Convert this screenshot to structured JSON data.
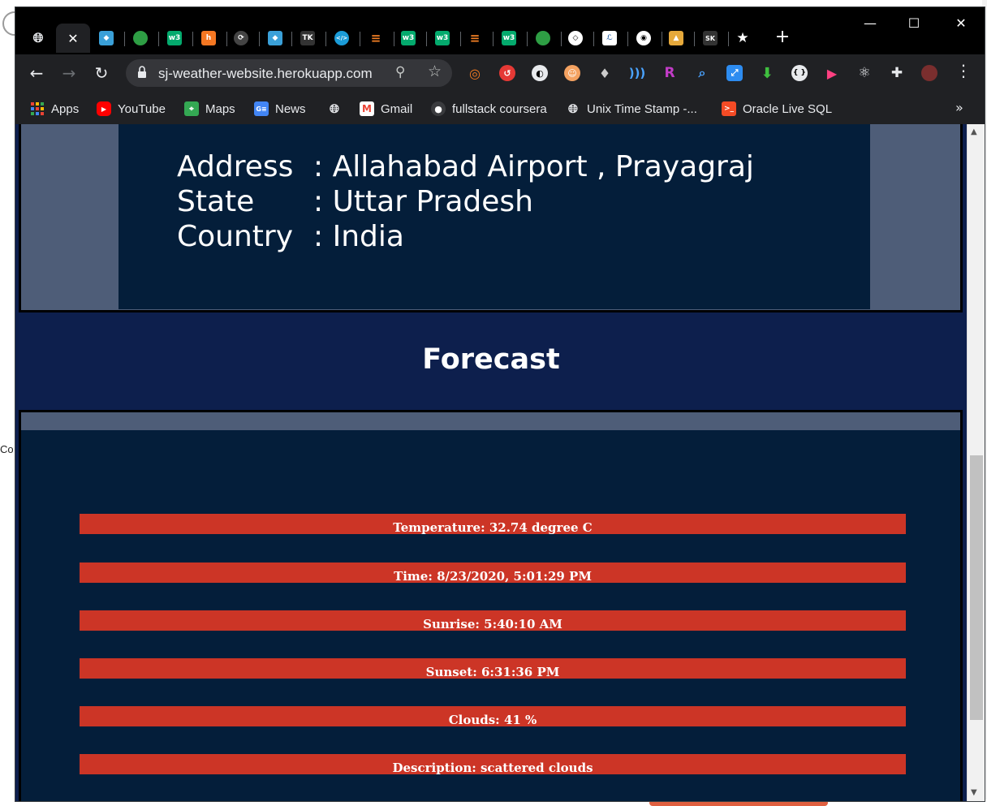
{
  "browser": {
    "url": "sj-weather-website.herokuapp.com",
    "tabs": [
      {
        "icon": "globe-icon",
        "color": "#5f6368"
      },
      {
        "icon": "close-icon",
        "active": true
      },
      {
        "icon": "bird-icon",
        "color": "#3aa0d8"
      },
      {
        "icon": "hexagon-icon",
        "color": "#2e9e44"
      },
      {
        "icon": "w3-icon",
        "color": "#04aa6d"
      },
      {
        "icon": "hubspot-icon",
        "color": "#f57722"
      },
      {
        "icon": "link-icon",
        "color": "#444"
      },
      {
        "icon": "bird-icon",
        "color": "#3aa0d8"
      },
      {
        "icon": "tk-icon",
        "color": "#333"
      },
      {
        "icon": "code-icon",
        "color": "#1b9cd8"
      },
      {
        "icon": "stackoverflow-icon",
        "color": "#f48024"
      },
      {
        "icon": "w3-icon",
        "color": "#04aa6d"
      },
      {
        "icon": "w3-icon",
        "color": "#04aa6d"
      },
      {
        "icon": "stackoverflow-icon",
        "color": "#f48024"
      },
      {
        "icon": "w3-icon",
        "color": "#04aa6d"
      },
      {
        "icon": "leaf-icon",
        "color": "#2e9e44"
      },
      {
        "icon": "codepen-icon",
        "color": "#000"
      },
      {
        "icon": "script-icon",
        "color": "#fff"
      },
      {
        "icon": "chrome-icon",
        "color": "#000"
      },
      {
        "icon": "image-icon",
        "color": "#e6a93b"
      },
      {
        "icon": "sk-icon",
        "color": "#333"
      },
      {
        "icon": "star-icon",
        "color": "#000"
      }
    ],
    "tab_text": {
      "tk": "TK",
      "sk": "SK",
      "w3": "w3",
      "hub": "h",
      "code": "</>"
    },
    "bookmarks": [
      {
        "label": "Apps",
        "icon": "apps-grid-icon"
      },
      {
        "label": "YouTube",
        "icon": "youtube-icon",
        "color": "#ff0000"
      },
      {
        "label": "Maps",
        "icon": "maps-icon",
        "color": "#34a853"
      },
      {
        "label": "News",
        "icon": "news-icon",
        "color": "#4285f4"
      },
      {
        "label": "",
        "icon": "globe-icon"
      },
      {
        "label": "Gmail",
        "icon": "gmail-icon",
        "color": "#ea4335"
      },
      {
        "label": "fullstack coursera",
        "icon": "github-icon"
      },
      {
        "label": "Unix Time Stamp -...",
        "icon": "globe-icon"
      },
      {
        "label": "Oracle Live SQL",
        "icon": "oracle-sql-icon",
        "color": "#f44b25"
      }
    ]
  },
  "location": {
    "address_label": "Address",
    "address_value": ": Allahabad Airport , Prayagraj",
    "state_label": "State",
    "state_value": ": Uttar Pradesh",
    "country_label": "Country",
    "country_value": ": India"
  },
  "forecast": {
    "title": "Forecast",
    "items": [
      "Temperature: 32.74 degree C",
      "Time: 8/23/2020, 5:01:29 PM",
      "Sunrise: 5:40:10 AM",
      "Sunset: 6:31:36 PM",
      "Clouds: 41 %",
      "Description: scattered clouds"
    ]
  },
  "colors": {
    "page_bg": "#0d1f4d",
    "panel_bg": "#041e3a",
    "panel_frame": "#4e5d78",
    "item_bg": "#cc3526"
  },
  "desktop": {
    "left_text": "Co"
  }
}
